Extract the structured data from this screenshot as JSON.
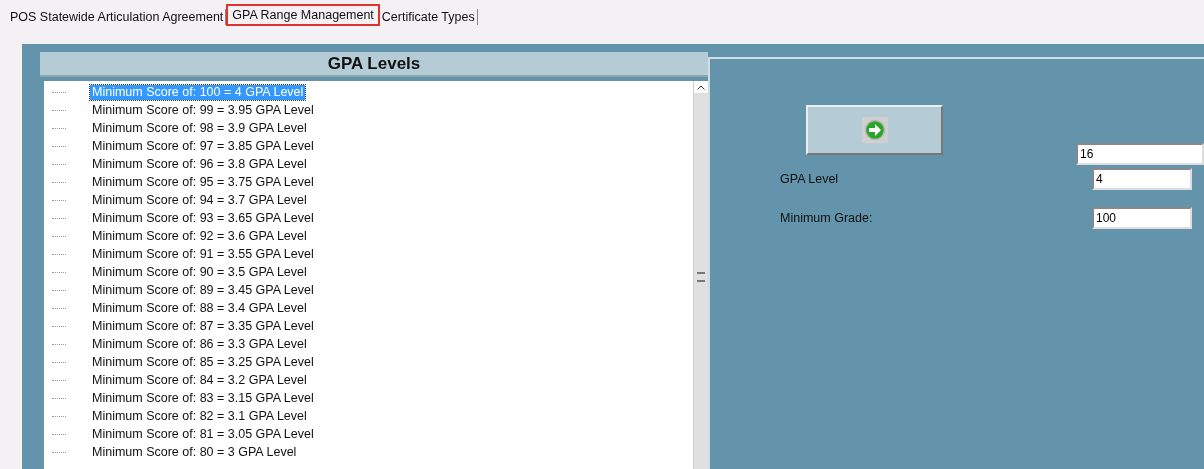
{
  "tabs": [
    {
      "label": "POS Statewide Articulation Agreement",
      "selected": false
    },
    {
      "label": "GPA Range Management",
      "selected": true
    },
    {
      "label": "Certificate Types",
      "selected": false
    }
  ],
  "gpa_levels": {
    "title": "GPA Levels",
    "items": [
      {
        "label": "Minimum Score of: 100 = 4 GPA Level",
        "selected": true
      },
      {
        "label": "Minimum Score of: 99 = 3.95 GPA Level",
        "selected": false
      },
      {
        "label": "Minimum Score of: 98 = 3.9 GPA Level",
        "selected": false
      },
      {
        "label": "Minimum Score of: 97 = 3.85 GPA Level",
        "selected": false
      },
      {
        "label": "Minimum Score of: 96 = 3.8 GPA Level",
        "selected": false
      },
      {
        "label": "Minimum Score of: 95 = 3.75 GPA Level",
        "selected": false
      },
      {
        "label": "Minimum Score of: 94 = 3.7 GPA Level",
        "selected": false
      },
      {
        "label": "Minimum Score of: 93 = 3.65 GPA Level",
        "selected": false
      },
      {
        "label": "Minimum Score of: 92 = 3.6 GPA Level",
        "selected": false
      },
      {
        "label": "Minimum Score of: 91 = 3.55 GPA Level",
        "selected": false
      },
      {
        "label": "Minimum Score of: 90 = 3.5 GPA Level",
        "selected": false
      },
      {
        "label": "Minimum Score of: 89 = 3.45 GPA Level",
        "selected": false
      },
      {
        "label": "Minimum Score of: 88 = 3.4 GPA Level",
        "selected": false
      },
      {
        "label": "Minimum Score of: 87 = 3.35 GPA Level",
        "selected": false
      },
      {
        "label": "Minimum Score of: 86 = 3.3 GPA Level",
        "selected": false
      },
      {
        "label": "Minimum Score of: 85 = 3.25 GPA Level",
        "selected": false
      },
      {
        "label": "Minimum Score of: 84 = 3.2 GPA Level",
        "selected": false
      },
      {
        "label": "Minimum Score of: 83 = 3.15 GPA Level",
        "selected": false
      },
      {
        "label": "Minimum Score of: 82 = 3.1 GPA Level",
        "selected": false
      },
      {
        "label": "Minimum Score of: 81 = 3.05 GPA Level",
        "selected": false
      },
      {
        "label": "Minimum Score of: 80 = 3 GPA Level",
        "selected": false
      }
    ]
  },
  "editor": {
    "id_value": "16",
    "fields": [
      {
        "label": "GPA Level",
        "value": "4"
      },
      {
        "label": "Minimum Grade:",
        "value": "100"
      }
    ]
  }
}
